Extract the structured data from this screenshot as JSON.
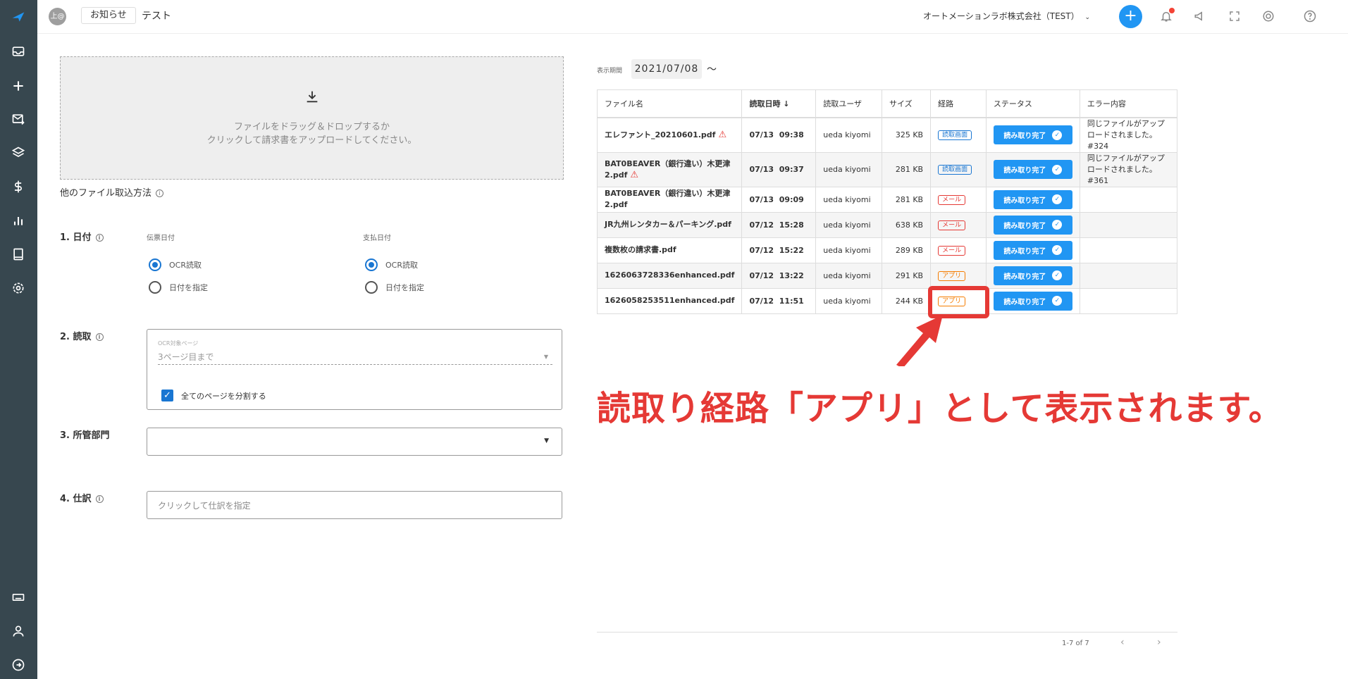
{
  "header": {
    "avatar": "上@",
    "notice_label": "お知らせ",
    "title": "テスト",
    "company": "オートメーションラボ株式会社（TEST）",
    "plus": "+"
  },
  "upload": {
    "line1": "ファイルをドラッグ＆ドロップするか",
    "line2": "クリックして請求書をアップロードしてください。",
    "other_methods": "他のファイル取込方法"
  },
  "date_section": {
    "label": "1. 日付",
    "invoice_date_label": "伝票日付",
    "payment_date_label": "支払日付",
    "opt_ocr": "OCR読取",
    "opt_specify": "日付を指定"
  },
  "read_section": {
    "label": "2. 読取",
    "ocr_pages_label": "OCR対象ページ",
    "ocr_pages_value": "3ページ目まで",
    "split_label": "全てのページを分割する"
  },
  "dept_section": {
    "label": "3. 所管部門"
  },
  "journal_section": {
    "label": "4. 仕訳",
    "placeholder": "クリックして仕訳を指定"
  },
  "period": {
    "label": "表示期間",
    "date": "2021/07/08",
    "tilde": "〜"
  },
  "table": {
    "headers": [
      "ファイル名",
      "読取日時",
      "読取ユーザ",
      "サイズ",
      "経路",
      "ステータス",
      "エラー内容"
    ],
    "rows": [
      {
        "file": "エレファント_20210601.pdf",
        "date": "07/13",
        "time": "09:38",
        "user": "ueda kiyomi",
        "size": "325 KB",
        "route": "読取画面",
        "status": "読み取り完了",
        "error": "同じファイルがアップロードされました。#324"
      },
      {
        "file": "BAT0BEAVER（銀行違い）木更津2.pdf",
        "date": "07/13",
        "time": "09:37",
        "user": "ueda kiyomi",
        "size": "281 KB",
        "route": "読取画面",
        "status": "読み取り完了",
        "error": "同じファイルがアップロードされました。#361"
      },
      {
        "file": "BAT0BEAVER（銀行違い）木更津2.pdf",
        "date": "07/13",
        "time": "09:09",
        "user": "ueda kiyomi",
        "size": "281 KB",
        "route": "メール",
        "status": "読み取り完了",
        "error": ""
      },
      {
        "file": "JR九州レンタカー＆パーキング.pdf",
        "date": "07/12",
        "time": "15:28",
        "user": "ueda kiyomi",
        "size": "638 KB",
        "route": "メール",
        "status": "読み取り完了",
        "error": ""
      },
      {
        "file": "複数枚の請求書.pdf",
        "date": "07/12",
        "time": "15:22",
        "user": "ueda kiyomi",
        "size": "289 KB",
        "route": "メール",
        "status": "読み取り完了",
        "error": ""
      },
      {
        "file": "1626063728336enhanced.pdf",
        "date": "07/12",
        "time": "13:22",
        "user": "ueda kiyomi",
        "size": "291 KB",
        "route": "アプリ",
        "status": "読み取り完了",
        "error": ""
      },
      {
        "file": "1626058253511enhanced.pdf",
        "date": "07/12",
        "time": "11:51",
        "user": "ueda kiyomi",
        "size": "244 KB",
        "route": "アプリ",
        "status": "読み取り完了",
        "error": ""
      }
    ]
  },
  "annotation": "読取り経路「アプリ」として表示されます。",
  "pager": {
    "text": "1-7 of 7",
    "prev": "‹",
    "next": "›"
  },
  "colors": {
    "sidebar": "#37474f",
    "primary": "#2196f3",
    "annotation": "#e53935",
    "app_route": "#f57c00"
  }
}
